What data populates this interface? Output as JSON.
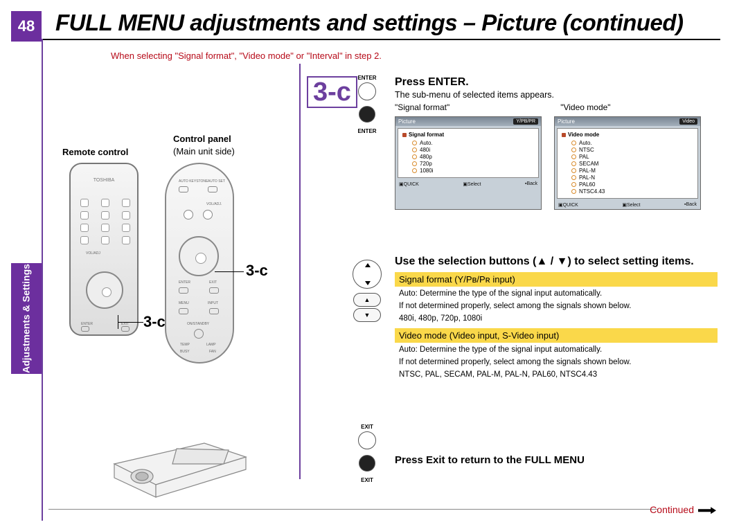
{
  "page_number": "48",
  "title": "FULL MENU adjustments and settings – Picture (continued)",
  "side_tab": "Adjustments & Settings",
  "intro_red": "When selecting \"Signal format\", \"Video mode\" or \"Interval\"  in step 2.",
  "left": {
    "remote_label": "Remote control",
    "control_panel_label": "Control panel",
    "main_unit_side": "(Main unit side)",
    "brand": "TOSHIBA",
    "callout_a": "3-c",
    "callout_b": "3-c",
    "remote_labels": {
      "enter": "ENTER",
      "exit": "EXIT",
      "voladj": "VOL/ADJ"
    },
    "panel_labels": {
      "auto_keystone": "AUTO KEYSTONE",
      "auto_set": "AUTO SET",
      "voladj": "VOL/ADJ.",
      "enter": "ENTER",
      "exit": "EXIT",
      "menu": "MENU",
      "input": "INPUT",
      "standby": "ON/STANDBY",
      "temp": "TEMP",
      "lamp": "LAMP",
      "busy": "BUSY",
      "fan": "FAN"
    }
  },
  "step_marker": "3-c",
  "section1": {
    "heading": "Press ENTER.",
    "desc": "The sub-menu of selected items appears.",
    "caption_l": "\"Signal format\"",
    "caption_r": "\"Video mode\"",
    "btn_upper": "ENTER",
    "btn_lower": "ENTER",
    "menu_left": {
      "header": "Picture",
      "tag": "Y/PB/PR",
      "title": "Signal format",
      "options": [
        "Auto.",
        "480i",
        "480p",
        "720p",
        "1080i"
      ],
      "footer_l": "QUICK",
      "footer_m": "Select",
      "footer_r": "Back"
    },
    "menu_right": {
      "header": "Picture",
      "tag": "Video",
      "title": "Video mode",
      "options": [
        "Auto.",
        "NTSC",
        "PAL",
        "SECAM",
        "PAL-M",
        "PAL-N",
        "PAL60",
        "NTSC4.43"
      ],
      "footer_l": "QUICK",
      "footer_m": "Select",
      "footer_r": "Back"
    }
  },
  "section2": {
    "heading": "Use the selection buttons (▲ / ▼) to select setting items.",
    "yellow1": "Signal format (Y/Pʙ/Pʀ input)",
    "exp1a": "Auto:   Determine the type of the signal input automatically.",
    "exp1b": "If not determined properly, select among the signals shown below.",
    "exp1c": "480i, 480p, 720p, 1080i",
    "yellow2": "Video mode (Video input, S-Video input)",
    "exp2a": "Auto:   Determine the type of the signal input automatically.",
    "exp2b": "If not determined properly, select among the signals shown below.",
    "exp2c": "NTSC, PAL, SECAM, PAL-M, PAL-N, PAL60, NTSC4.43"
  },
  "section3": {
    "heading": "Press Exit to return to the FULL MENU",
    "btn_upper": "EXIT",
    "btn_lower": "EXIT"
  },
  "continued": "Continued"
}
